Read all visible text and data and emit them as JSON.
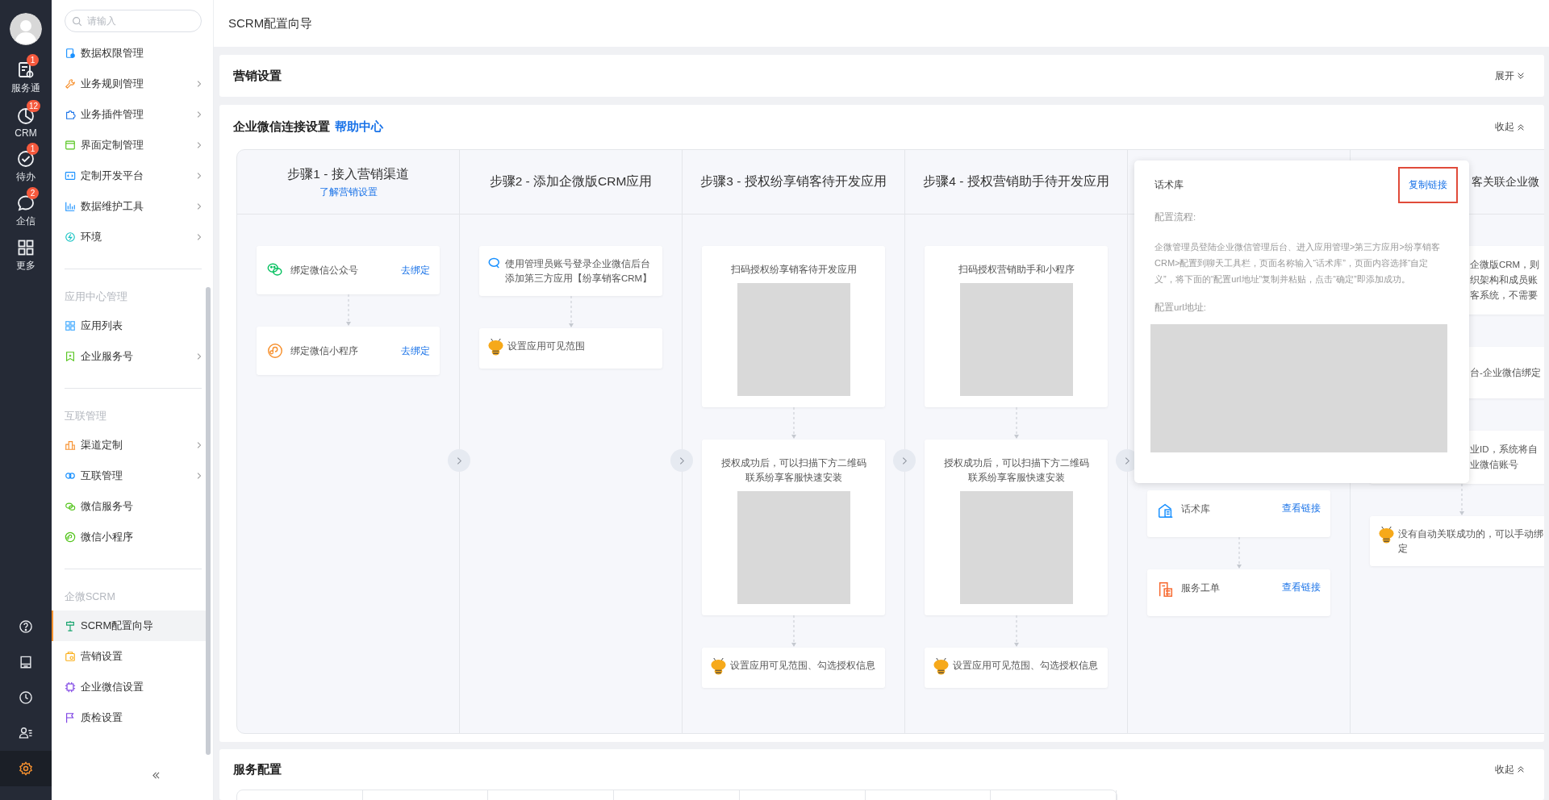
{
  "rail": {
    "nav": [
      {
        "label": "服务通",
        "badge": "1",
        "selected": false
      },
      {
        "label": "CRM",
        "badge": "12",
        "selected": false
      },
      {
        "label": "待办",
        "badge": "1",
        "selected": false
      },
      {
        "label": "企信",
        "badge": "2",
        "selected": false
      },
      {
        "label": "更多",
        "selected": false
      }
    ],
    "tools": [
      {
        "selected": false
      },
      {
        "selected": false
      },
      {
        "selected": false
      },
      {
        "selected": false
      },
      {
        "selected": true
      }
    ]
  },
  "sidebar": {
    "search": {
      "placeholder": "请输入"
    },
    "groups": [
      {
        "items": [
          {
            "label": "数据权限管理",
            "expandable": false,
            "selected": false
          },
          {
            "label": "业务规则管理",
            "expandable": true,
            "selected": false
          },
          {
            "label": "业务插件管理",
            "expandable": true,
            "selected": false
          },
          {
            "label": "界面定制管理",
            "expandable": true,
            "selected": false
          },
          {
            "label": "定制开发平台",
            "expandable": true,
            "selected": false
          },
          {
            "label": "数据维护工具",
            "expandable": true,
            "selected": false
          },
          {
            "label": "环境",
            "expandable": true,
            "selected": false
          }
        ]
      },
      {
        "label": "应用中心管理",
        "items": [
          {
            "label": "应用列表",
            "expandable": false,
            "selected": false
          },
          {
            "label": "企业服务号",
            "expandable": true,
            "selected": false
          }
        ]
      },
      {
        "label": "互联管理",
        "items": [
          {
            "label": "渠道定制",
            "expandable": true,
            "selected": false
          },
          {
            "label": "互联管理",
            "expandable": true,
            "selected": false
          },
          {
            "label": "微信服务号",
            "expandable": false,
            "selected": false
          },
          {
            "label": "微信小程序",
            "expandable": false,
            "selected": false
          }
        ]
      },
      {
        "label": "企微SCRM",
        "items": [
          {
            "label": "SCRM配置向导",
            "expandable": false,
            "selected": true
          },
          {
            "label": "营销设置",
            "expandable": false,
            "selected": false
          },
          {
            "label": "企业微信设置",
            "expandable": false,
            "selected": false
          },
          {
            "label": "质检设置",
            "expandable": false,
            "selected": false
          }
        ]
      }
    ]
  },
  "header": {
    "title": "SCRM配置向导"
  },
  "sections": [
    {
      "title": "营销设置",
      "toggle": "展开",
      "expanded": false
    },
    {
      "title": "企业微信连接设置",
      "link": "帮助中心",
      "toggle": "收起",
      "expanded": true,
      "steps": [
        {
          "kind": "full",
          "title": "步骤1 - 接入营销渠道",
          "link": "了解营销设置",
          "cards": [
            {
              "kind": "action",
              "text": "绑定微信公众号",
              "action": "去绑定"
            },
            {
              "kind": "action",
              "text": "绑定微信小程序",
              "action": "去绑定"
            }
          ]
        },
        {
          "kind": "full",
          "title": "步骤2 - 添加企微版CRM应用",
          "cards": [
            {
              "kind": "note",
              "text": "使用管理员账号登录企业微信后台添加第三方应用【纷享销客CRM】"
            },
            {
              "kind": "mascot",
              "text": "设置应用可见范围"
            }
          ]
        },
        {
          "kind": "full",
          "title": "步骤3 - 授权纷享销客待开发应用",
          "cards": [
            {
              "kind": "qr",
              "lines": [
                "扫码授权纷享销客待开发应用"
              ]
            },
            {
              "kind": "qr",
              "lines": [
                "授权成功后，可以扫描下方二维码",
                "联系纷享客服快速安装"
              ]
            },
            {
              "kind": "mascot",
              "text": "设置应用可见范围、勾选授权信息"
            }
          ]
        },
        {
          "kind": "full",
          "title": "步骤4 - 授权营销助手待开发应用",
          "cards": [
            {
              "kind": "qr",
              "lines": [
                "扫码授权营销助手和小程序"
              ]
            },
            {
              "kind": "qr",
              "lines": [
                "授权成功后，可以扫描下方二维码",
                "联系纷享客服快速安装"
              ]
            },
            {
              "kind": "mascot",
              "text": "设置应用可见范围、勾选授权信息"
            }
          ]
        },
        {
          "kind": "covered",
          "cards": [
            {
              "kind": "action",
              "text": "话术库",
              "action": "查看链接"
            },
            {
              "kind": "action",
              "text": "服务工单",
              "action": "查看链接"
            }
          ]
        },
        {
          "kind": "partial",
          "title": "客关联企业微",
          "cards": [
            {
              "kind": "fragment",
              "lines": [
                "企微版CRM，则",
                "织架构和成员账",
                "客系统，不需要"
              ]
            },
            {
              "kind": "fragment",
              "lines": [
                "台-企业微信绑定"
              ]
            },
            {
              "kind": "fragment",
              "lines": [
                "业ID，系统将自",
                "业微信账号"
              ]
            },
            {
              "kind": "mascot",
              "text": "没有自动关联成功的，可以手动绑定"
            }
          ]
        }
      ],
      "popover": {
        "title": "话术库",
        "action": "复制链接",
        "highlighted": true,
        "process_label": "配置流程:",
        "process": "企微管理员登陆企业微信管理后台、进入应用管理>第三方应用>纷享销客CRM>配置到聊天工具栏，页面名称输入“话术库”，页面内容选择“自定义”，将下面的“配置url地址”复制并粘贴，点击“确定”即添加成功。",
        "url_label": "配置url地址:"
      }
    },
    {
      "title": "服务配置",
      "toggle": "收起",
      "expanded": true
    }
  ]
}
